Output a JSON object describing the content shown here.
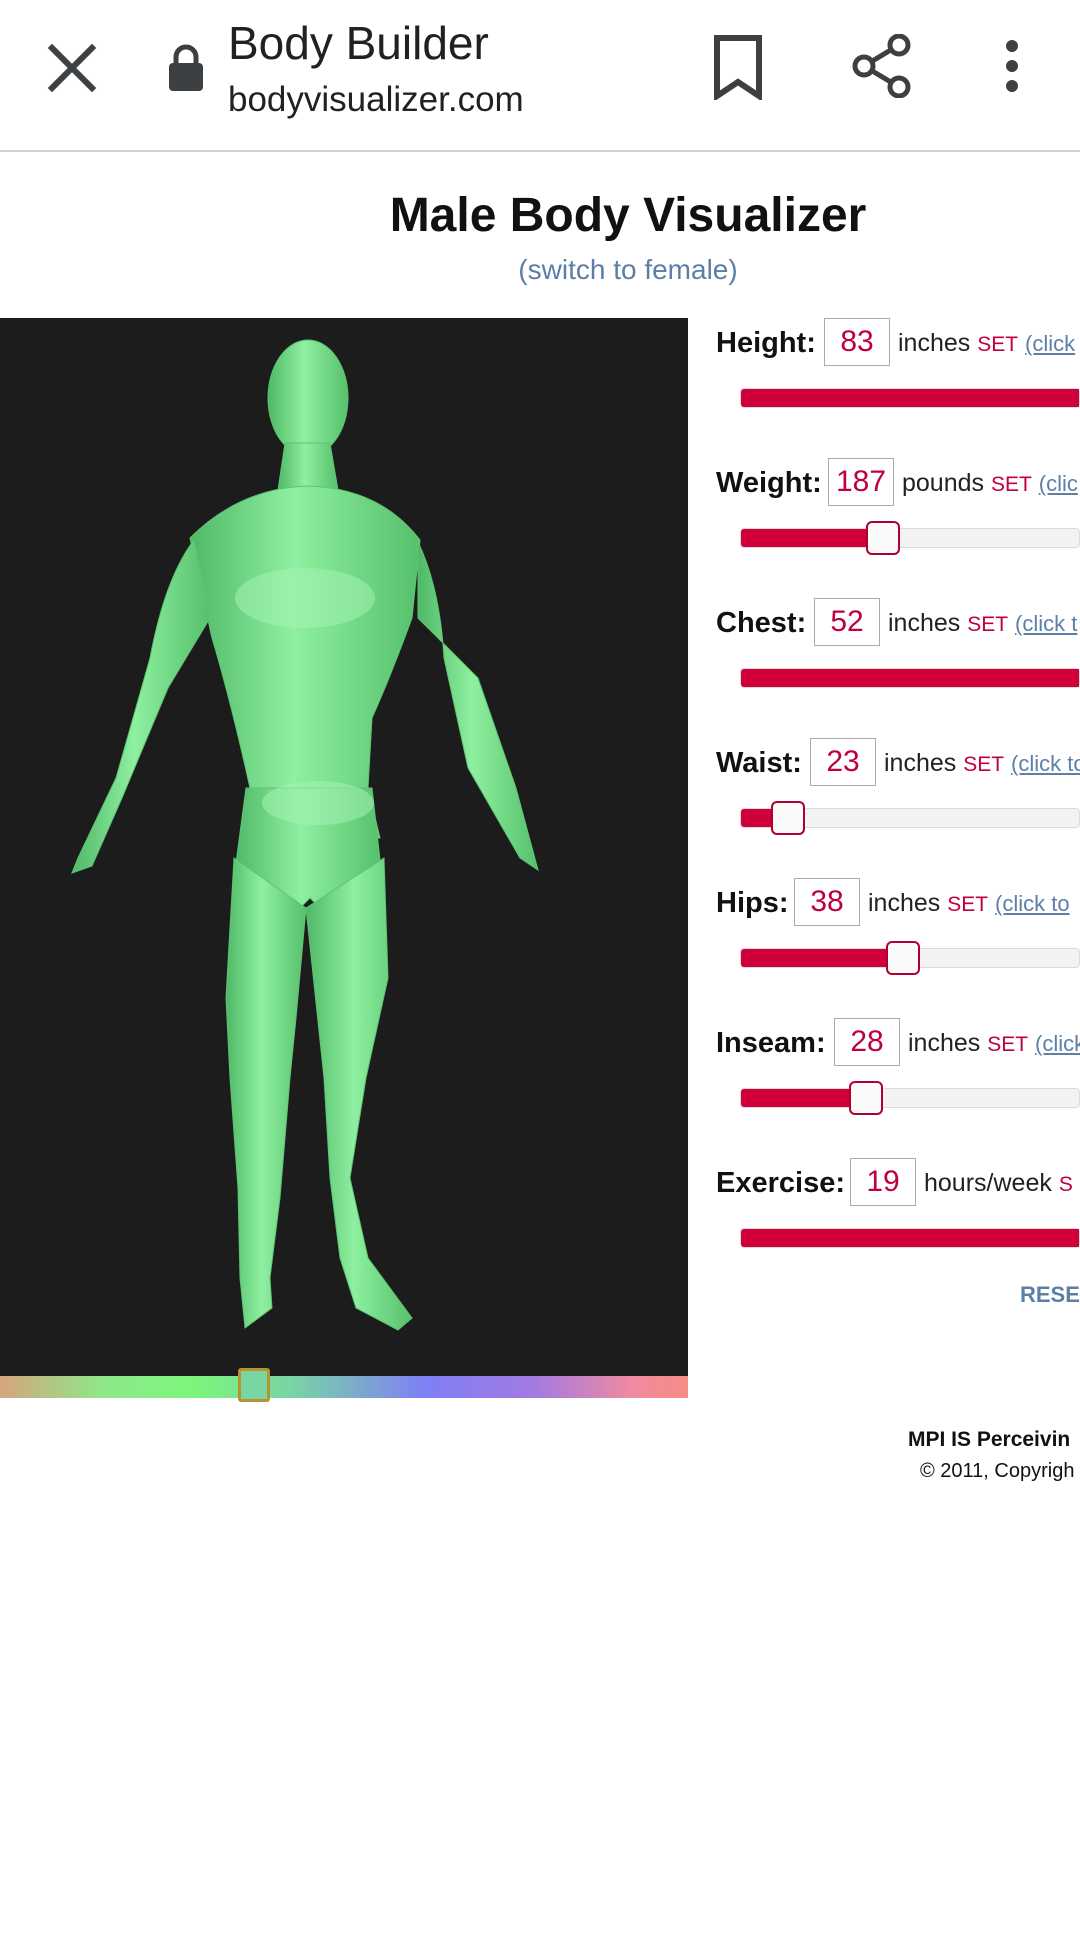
{
  "browser": {
    "title": "Body Builder",
    "url": "bodyvisualizer.com"
  },
  "page": {
    "title": "Male Body Visualizer",
    "switch_link": "(switch to female)"
  },
  "controls": [
    {
      "label": "Height:",
      "value": "83",
      "unit": "inches",
      "set": "SET",
      "click": "(click",
      "fill": 1.0
    },
    {
      "label": "Weight:",
      "value": "187",
      "unit": "pounds",
      "set": "SET",
      "click": "(clic",
      "fill": 0.42
    },
    {
      "label": "Chest:",
      "value": "52",
      "unit": "inches",
      "set": "SET",
      "click": "(click t",
      "fill": 1.0
    },
    {
      "label": "Waist:",
      "value": "23",
      "unit": "inches",
      "set": "SET",
      "click": "(click to",
      "fill": 0.14
    },
    {
      "label": "Hips:",
      "value": "38",
      "unit": "inches",
      "set": "SET",
      "click": "(click to",
      "fill": 0.48
    },
    {
      "label": "Inseam:",
      "value": "28",
      "unit": "inches",
      "set": "SET",
      "click": "(click",
      "fill": 0.37
    },
    {
      "label": "Exercise:",
      "value": "19",
      "unit": "hours/week",
      "set": "S",
      "click": "",
      "fill": 1.0
    }
  ],
  "reset_label": "RESET",
  "footer": {
    "line1": "MPI IS Perceivin",
    "line2": "© 2011, Copyrigh"
  },
  "colors": {
    "accent": "#d0003a",
    "link": "#5b7fa6",
    "viewer_bg": "#1c1c1c",
    "body_color": "#79e08a"
  },
  "color_slider_value": 0.37
}
